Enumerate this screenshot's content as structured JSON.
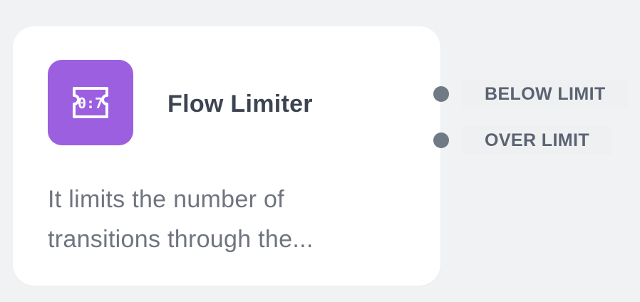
{
  "node": {
    "title": "Flow Limiter",
    "description_lines": [
      "It limits the number of",
      "transitions through the..."
    ],
    "icon": {
      "name": "counter-icon",
      "glyph": "0:7",
      "background": "#9b5fe0"
    }
  },
  "outputs": [
    {
      "label": "BELOW LIMIT",
      "dot_color": "#6f7a85"
    },
    {
      "label": "OVER LIMIT",
      "dot_color": "#6f7a85"
    }
  ],
  "colors": {
    "canvas": "#f1f2f4",
    "card": "#ffffff",
    "title_text": "#3d4451",
    "description_text": "#6f7480",
    "port_label_text": "#5b6372"
  }
}
